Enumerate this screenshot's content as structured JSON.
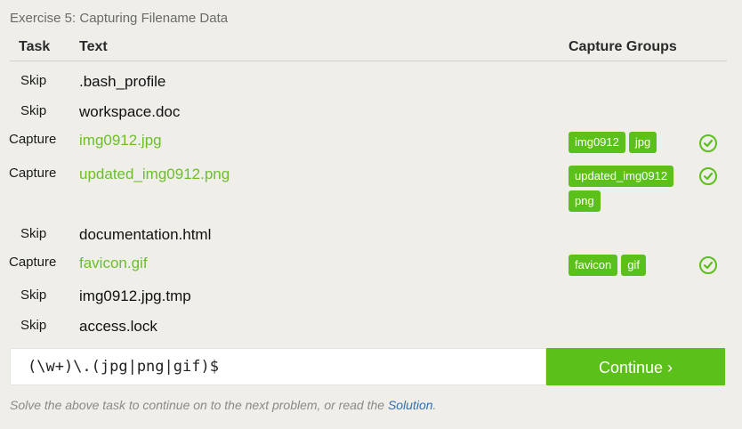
{
  "title": "Exercise 5: Capturing Filename Data",
  "headers": {
    "task": "Task",
    "text": "Text",
    "groups": "Capture Groups"
  },
  "rows": [
    {
      "task": "Skip",
      "text": ".bash_profile",
      "groups": []
    },
    {
      "task": "Skip",
      "text": "workspace.doc",
      "groups": []
    },
    {
      "task": "Capture",
      "text": "img0912.jpg",
      "groups": [
        "img0912",
        "jpg"
      ],
      "status": "check-circle-icon"
    },
    {
      "task": "Capture",
      "text": "updated_img0912.png",
      "groups": [
        "updated_img0912",
        "png"
      ],
      "status": "check-circle-icon"
    },
    {
      "task": "Skip",
      "text": "documentation.html",
      "groups": []
    },
    {
      "task": "Capture",
      "text": "favicon.gif",
      "groups": [
        "favicon",
        "gif"
      ],
      "status": "check-circle-icon"
    },
    {
      "task": "Skip",
      "text": "img0912.jpg.tmp",
      "groups": []
    },
    {
      "task": "Skip",
      "text": "access.lock",
      "groups": []
    }
  ],
  "regex_input": {
    "value": "(\\w+)\\.(jpg|png|gif)$"
  },
  "continue_label": "Continue ›",
  "footer": {
    "text": "Solve the above task to continue on to the next problem, or read the ",
    "link": "Solution",
    "suffix": "."
  },
  "colors": {
    "accent": "#5cc01b",
    "match_text": "#6cbf2a",
    "link": "#2f6fb5",
    "background": "#efeee9"
  }
}
